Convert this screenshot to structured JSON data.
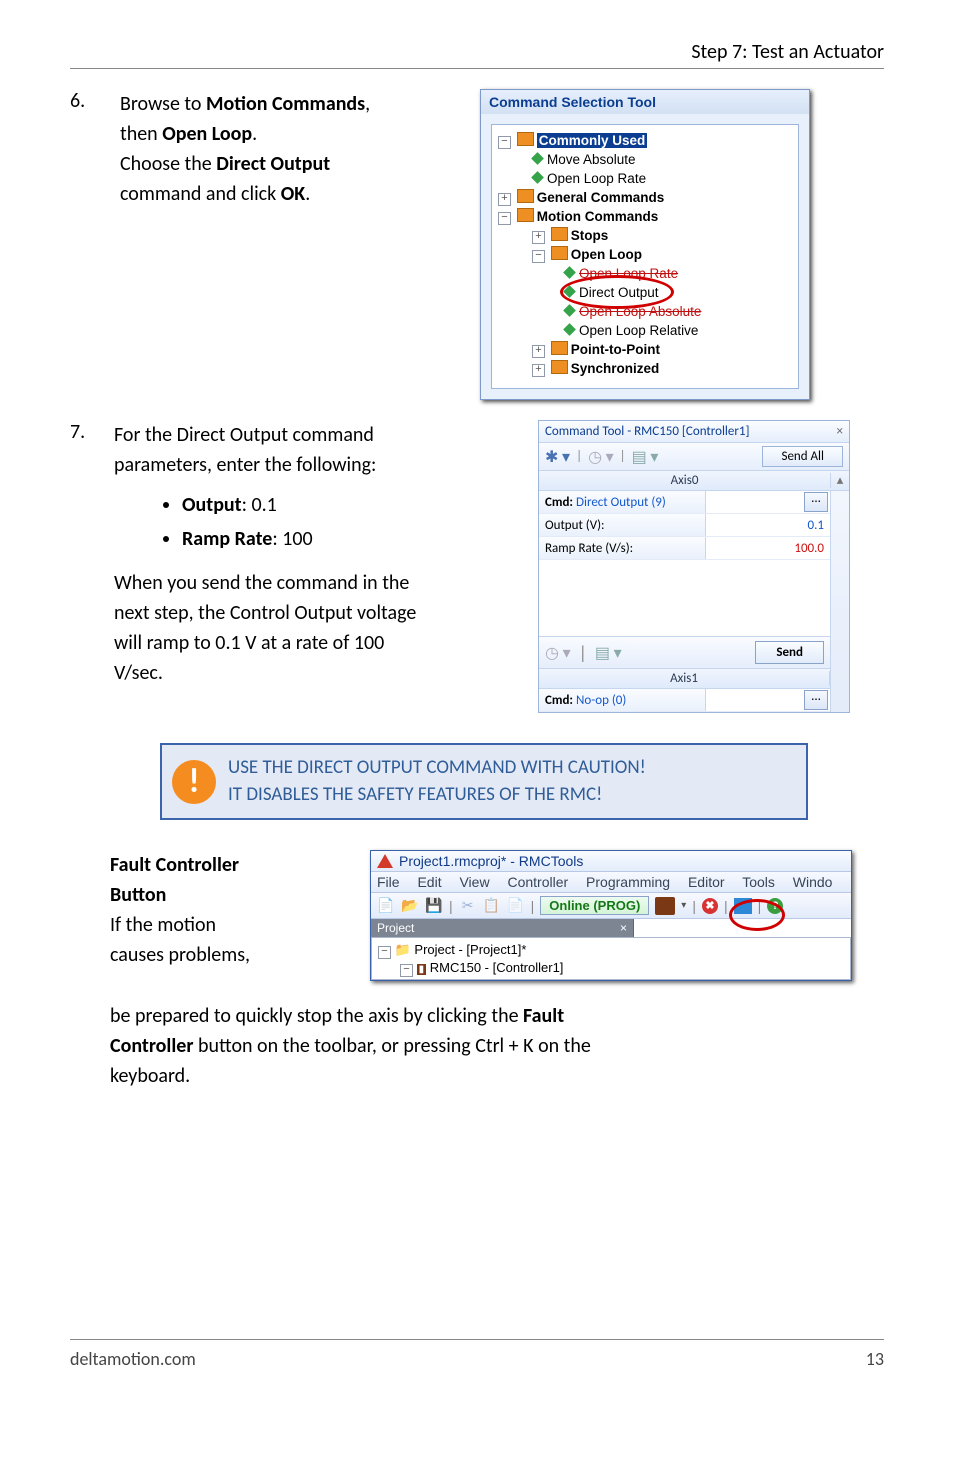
{
  "header": {
    "title": "Step 7: Test an Actuator"
  },
  "step6": {
    "num": "6.",
    "line1a": "Browse to ",
    "line1b_bold": "Motion Commands",
    "line1c": ",",
    "line2a": "then ",
    "line2b_bold": "Open Loop",
    "line2c": ".",
    "line3a": "Choose the ",
    "line3b_bold": "Direct Output",
    "line4a": "command and click ",
    "line4b_bold": "OK",
    "line4c": "."
  },
  "cst": {
    "title": "Command Selection Tool",
    "items": {
      "commonly_used": "Commonly Used",
      "move_abs": "Move Absolute",
      "open_loop_rate_top": "Open Loop Rate",
      "general": "General Commands",
      "motion": "Motion Commands",
      "stops": "Stops",
      "open_loop": "Open Loop",
      "open_loop_rate": "Open Loop Rate",
      "direct_output": "Direct Output",
      "open_loop_absolute": "Open Loop Absolute",
      "open_loop_relative": "Open Loop Relative",
      "ptp": "Point-to-Point",
      "sync": "Synchronized"
    }
  },
  "step7": {
    "num": "7.",
    "line1": "For the Direct Output command",
    "line2": "parameters, enter the following:",
    "bullet1_label": "Output",
    "bullet1_val": ": 0.1",
    "bullet2_label": "Ramp Rate",
    "bullet2_val": ": 100",
    "para1": "When you send the command in the",
    "para2": "next step, the Control Output voltage",
    "para3": "will ramp to 0.1 V at a rate of 100",
    "para4": "V/sec."
  },
  "ct": {
    "title": "Command Tool - RMC150 [Controller1]",
    "close": "×",
    "send_all": "Send All",
    "axis0": "Axis0",
    "axis1": "Axis1",
    "cmd_label": "Cmd:",
    "cmd_value": "Direct Output (9)",
    "output_label": "Output (V):",
    "output_value": "0.1",
    "ramp_label": "Ramp Rate (V/s):",
    "ramp_value": "100.0",
    "send": "Send",
    "noop": "No-op (0)",
    "dots": "..."
  },
  "callout": {
    "line1": "USE THE DIRECT OUTPUT COMMAND WITH CAUTION!",
    "line2": "IT DISABLES THE SAFETY FEATURES OF THE RMC!"
  },
  "fault": {
    "h1": "Fault Controller",
    "h2": "Button",
    "line1": "If the motion",
    "line2": "causes problems,",
    "para_a": "be prepared to quickly stop the axis by clicking the ",
    "para_b_bold": "Fault",
    "para_c_bold": "Controller",
    "para_d": " button on the toolbar, or pressing Ctrl + K on the",
    "para_e": "keyboard."
  },
  "rmct": {
    "title": "Project1.rmcproj* - RMCTools",
    "menu": {
      "file": "File",
      "edit": "Edit",
      "view": "View",
      "controller": "Controller",
      "programming": "Programming",
      "editor": "Editor",
      "tools": "Tools",
      "window": "Windo"
    },
    "online": "Online (PROG)",
    "project_hdr": "Project",
    "close": "×",
    "tree1": "Project - [Project1]*",
    "tree2": "RMC150 - [Controller1]"
  },
  "footer": {
    "left": "deltamotion.com",
    "right": "13"
  }
}
